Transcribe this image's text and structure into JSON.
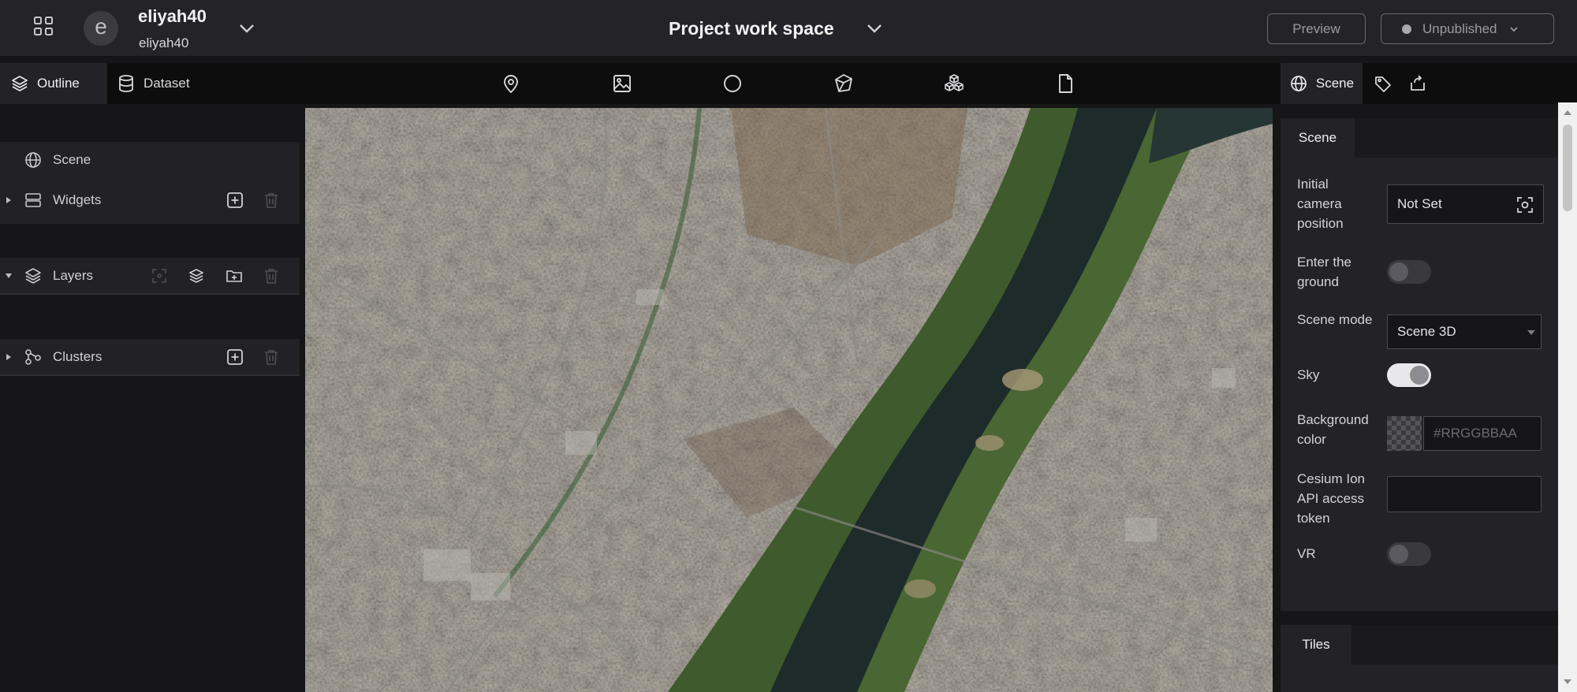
{
  "header": {
    "workspace_initial": "e",
    "workspace_name": "eliyah40",
    "workspace_user": "eliyah40",
    "project_title": "Project work space",
    "preview_label": "Preview",
    "publish_status": "Unpublished"
  },
  "left_panel": {
    "tabs": [
      {
        "label": "Outline",
        "icon": "layers-icon",
        "active": true
      },
      {
        "label": "Dataset",
        "icon": "database-icon",
        "active": false
      }
    ],
    "tree": {
      "scene": "Scene",
      "widgets": "Widgets",
      "layers": "Layers",
      "clusters": "Clusters"
    }
  },
  "toolbar": {
    "tools": [
      "map-pin-icon",
      "image-icon",
      "circle-icon",
      "3d-model-icon",
      "3d-tiles-icon",
      "file-icon"
    ]
  },
  "right_panel": {
    "tabs": [
      {
        "label": "Scene",
        "icon": "globe-icon",
        "active": true
      },
      {
        "label": "",
        "icon": "tag-icon",
        "active": false
      },
      {
        "label": "",
        "icon": "export-icon",
        "active": false
      }
    ],
    "scene_section": {
      "title": "Scene",
      "initial_camera_label": "Initial camera position",
      "initial_camera_value": "Not Set",
      "enter_ground_label": "Enter the ground",
      "enter_ground_on": false,
      "scene_mode_label": "Scene mode",
      "scene_mode_value": "Scene 3D",
      "sky_label": "Sky",
      "sky_on": true,
      "bg_color_label": "Background color",
      "bg_color_placeholder": "#RRGGBBAA",
      "cesium_label": "Cesium Ion API access token",
      "cesium_value": "",
      "vr_label": "VR",
      "vr_on": false
    },
    "tiles_section": {
      "title": "Tiles"
    }
  },
  "colors": {
    "header_bg": "#242428",
    "panel_bg": "#161619",
    "tab_bar_bg": "#0d0d0d",
    "section_bg": "#232327",
    "river": "#1d2b2a",
    "riverbank": "#3f5a2c"
  }
}
